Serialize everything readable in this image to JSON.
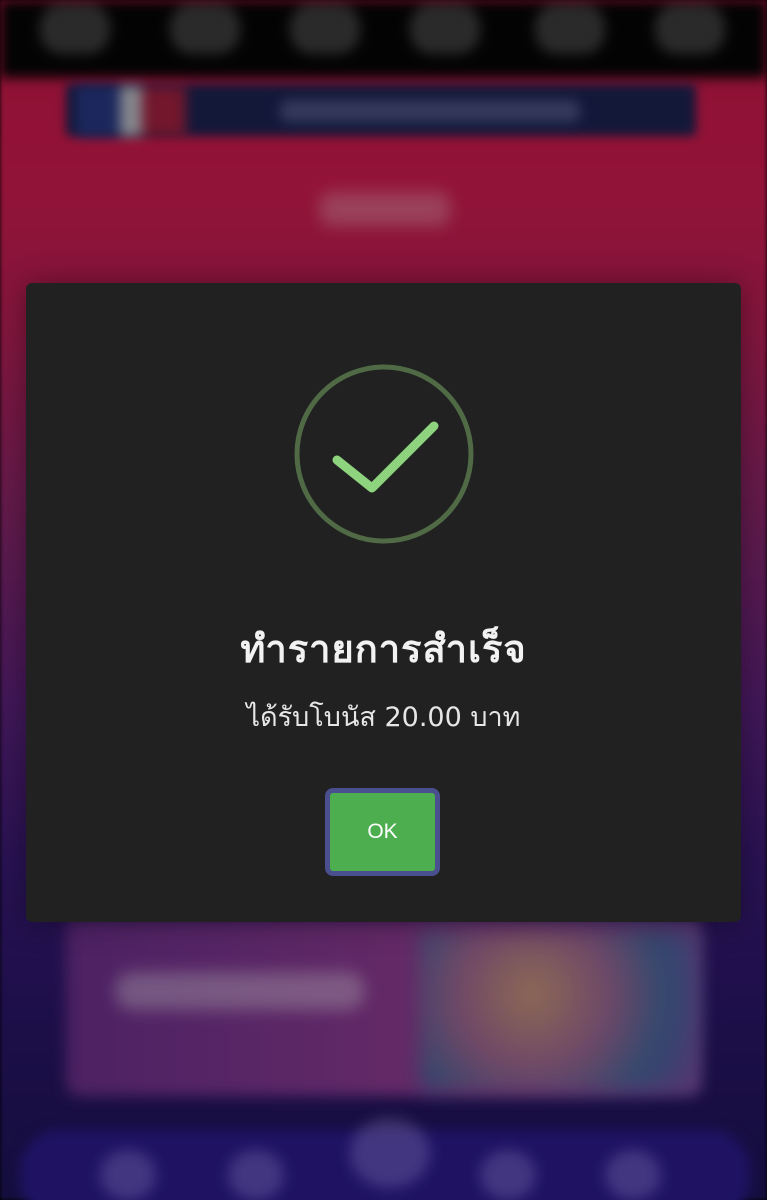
{
  "dialog": {
    "icon": "check-circle-icon",
    "title": "ทำรายการสำเร็จ",
    "message": "ได้รับโบนัส 20.00 บาท",
    "ok_label": "OK"
  },
  "colors": {
    "modal_background": "#212121",
    "success_green": "#8ed47e",
    "success_ring": "#4f6a45",
    "ok_button": "#4cae4f",
    "ok_button_border": "#4a4f8f"
  }
}
